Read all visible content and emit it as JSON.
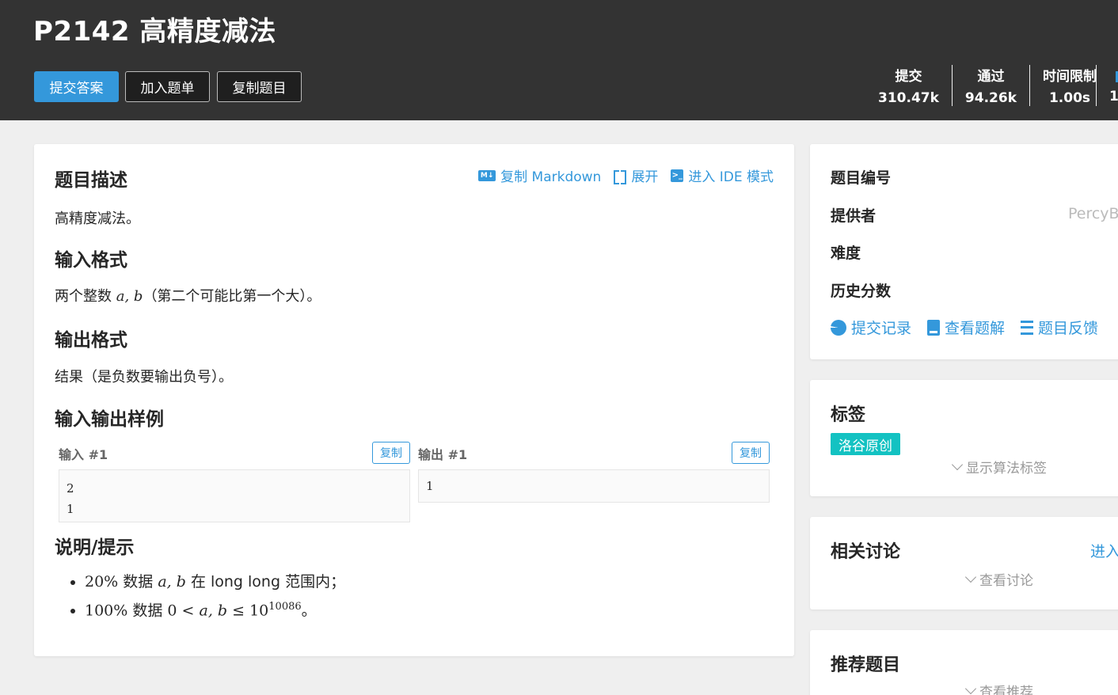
{
  "header": {
    "title": "P2142 高精度减法",
    "buttons": {
      "submit": "提交答案",
      "add_list": "加入题单",
      "copy": "复制题目"
    },
    "stats": [
      {
        "label": "提交",
        "value": "310.47k"
      },
      {
        "label": "通过",
        "value": "94.26k"
      },
      {
        "label": "时间限制",
        "value": "1.00s"
      }
    ],
    "stat_cut_value": "1"
  },
  "main": {
    "tools": {
      "copy_md": "复制 Markdown",
      "expand": "展开",
      "ide": "进入 IDE 模式"
    },
    "md_icon_text": "M↓",
    "desc_title": "题目描述",
    "desc_text": "高精度减法。",
    "input_title": "输入格式",
    "input_text_pre": "两个整数 ",
    "input_text_math": "a, b",
    "input_text_post": "（第二个可能比第一个大）。",
    "output_title": "输出格式",
    "output_text": "结果（是负数要输出负号）。",
    "samples_title": "输入输出样例",
    "sample_in_label": "输入 #1",
    "sample_out_label": "输出 #1",
    "copy_label": "复制",
    "sample_in_lines": [
      "2",
      "1"
    ],
    "sample_out_lines": [
      "1"
    ],
    "hint_title": "说明/提示",
    "hint1": {
      "pct": "20%",
      "word": " 数据 ",
      "vars": "a, b",
      "rest": " 在 long long 范围内；"
    },
    "hint2": {
      "pct": "100%",
      "word": " 数据 ",
      "zero": "0",
      "lt": " < ",
      "vars": "a, b",
      "le": " ≤ ",
      "base": "10",
      "exp": "10086",
      "end": "。"
    }
  },
  "sidebar": {
    "info": {
      "labels": {
        "id": "题目编号",
        "provider": "提供者",
        "difficulty": "难度",
        "history": "历史分数"
      },
      "provider_value": "PercyB",
      "links": {
        "records": "提交记录",
        "solutions": "查看题解",
        "feedback": "题目反馈"
      }
    },
    "tags": {
      "title": "标签",
      "tag": "洛谷原创",
      "toggle": "显示算法标签"
    },
    "discuss": {
      "title": "相关讨论",
      "enter": "进入",
      "toggle": "查看讨论"
    },
    "recommend": {
      "title": "推荐题目",
      "toggle": "查看推荐"
    }
  },
  "colors": {
    "accent": "#3498db",
    "header_bg": "#333333",
    "tag_bg": "#13c2c2"
  }
}
